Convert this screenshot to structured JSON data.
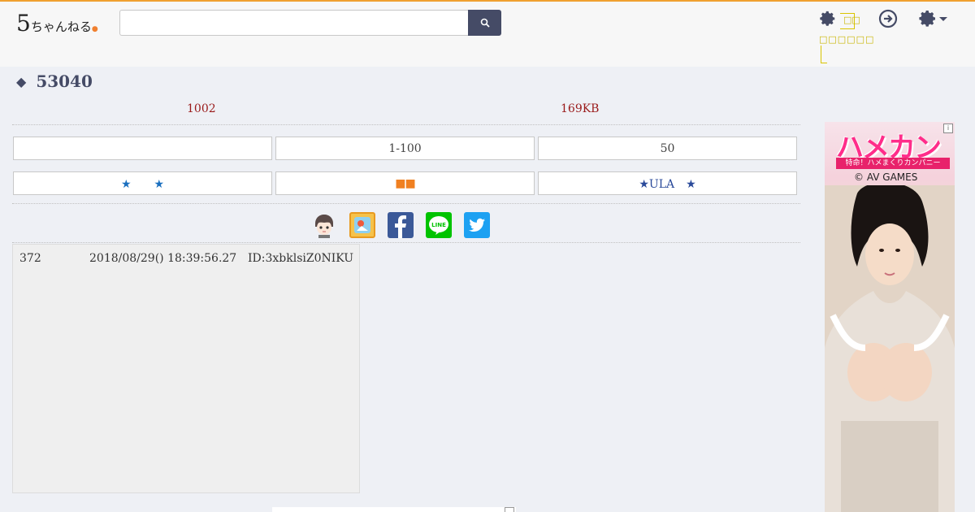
{
  "header": {
    "logo_main": "5",
    "logo_text": "ちゃんねる",
    "search_placeholder": "",
    "settings_label_1": "",
    "settings_label_2": ""
  },
  "thread": {
    "title": "53040",
    "response_count": "1002",
    "size": "169KB"
  },
  "buttons_row1": [
    "",
    "1-100",
    "50"
  ],
  "buttons_row2": [
    "★　　★",
    "■■",
    "★ULA　★"
  ],
  "share_icons": [
    "character-icon",
    "bookmark-app-icon",
    "facebook-icon",
    "line-icon",
    "twitter-icon"
  ],
  "post": {
    "number": "372",
    "date": "2018/08/29() 18:39:56.27",
    "id": "ID:3xbklsiZ0NIKU"
  },
  "ad": {
    "title": "ハメカン",
    "subtitle": "特命！ハメまくりカンパニー",
    "brand": "© AV GAMES",
    "badge": "i"
  },
  "colors": {
    "accent": "#454b66",
    "count_red": "#9a1a1a",
    "topline": "#f0a030",
    "facebook": "#3b5998",
    "line": "#00c300",
    "twitter": "#1da1f2"
  }
}
